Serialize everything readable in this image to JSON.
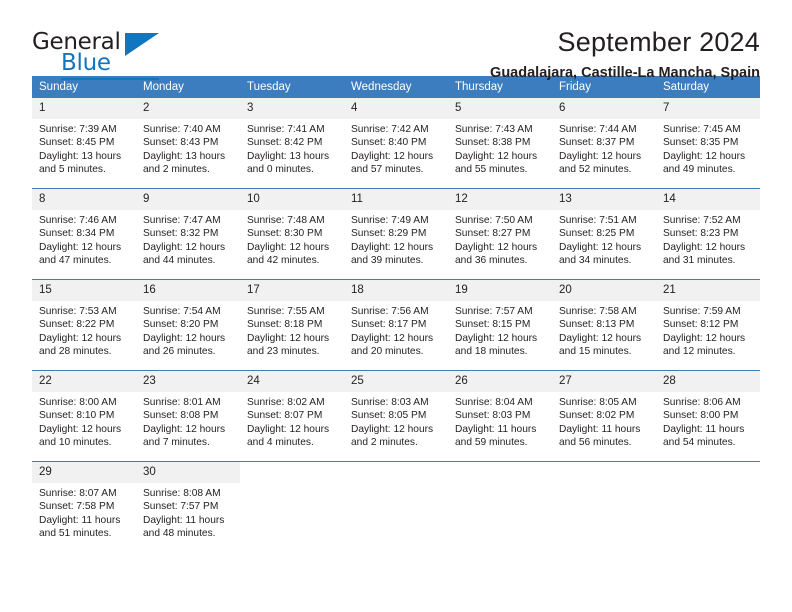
{
  "brand": {
    "name_top": "General",
    "name_bottom": "Blue",
    "accent_color": "#1175c0"
  },
  "header": {
    "title": "September 2024",
    "subtitle": "Guadalajara, Castille-La Mancha, Spain"
  },
  "theme": {
    "header_row_bg": "#3b7dbf",
    "daynum_bg": "#f1f1f1",
    "text_color": "#231f20",
    "grid_line": "#3b7dbf"
  },
  "weekday_headers": [
    "Sunday",
    "Monday",
    "Tuesday",
    "Wednesday",
    "Thursday",
    "Friday",
    "Saturday"
  ],
  "labels": {
    "sunrise_prefix": "Sunrise:",
    "sunset_prefix": "Sunset:",
    "daylight_prefix": "Daylight:"
  },
  "weeks": [
    [
      {
        "day": "1",
        "sunrise": "Sunrise: 7:39 AM",
        "sunset": "Sunset: 8:45 PM",
        "daylight_1": "Daylight: 13 hours",
        "daylight_2": "and 5 minutes."
      },
      {
        "day": "2",
        "sunrise": "Sunrise: 7:40 AM",
        "sunset": "Sunset: 8:43 PM",
        "daylight_1": "Daylight: 13 hours",
        "daylight_2": "and 2 minutes."
      },
      {
        "day": "3",
        "sunrise": "Sunrise: 7:41 AM",
        "sunset": "Sunset: 8:42 PM",
        "daylight_1": "Daylight: 13 hours",
        "daylight_2": "and 0 minutes."
      },
      {
        "day": "4",
        "sunrise": "Sunrise: 7:42 AM",
        "sunset": "Sunset: 8:40 PM",
        "daylight_1": "Daylight: 12 hours",
        "daylight_2": "and 57 minutes."
      },
      {
        "day": "5",
        "sunrise": "Sunrise: 7:43 AM",
        "sunset": "Sunset: 8:38 PM",
        "daylight_1": "Daylight: 12 hours",
        "daylight_2": "and 55 minutes."
      },
      {
        "day": "6",
        "sunrise": "Sunrise: 7:44 AM",
        "sunset": "Sunset: 8:37 PM",
        "daylight_1": "Daylight: 12 hours",
        "daylight_2": "and 52 minutes."
      },
      {
        "day": "7",
        "sunrise": "Sunrise: 7:45 AM",
        "sunset": "Sunset: 8:35 PM",
        "daylight_1": "Daylight: 12 hours",
        "daylight_2": "and 49 minutes."
      }
    ],
    [
      {
        "day": "8",
        "sunrise": "Sunrise: 7:46 AM",
        "sunset": "Sunset: 8:34 PM",
        "daylight_1": "Daylight: 12 hours",
        "daylight_2": "and 47 minutes."
      },
      {
        "day": "9",
        "sunrise": "Sunrise: 7:47 AM",
        "sunset": "Sunset: 8:32 PM",
        "daylight_1": "Daylight: 12 hours",
        "daylight_2": "and 44 minutes."
      },
      {
        "day": "10",
        "sunrise": "Sunrise: 7:48 AM",
        "sunset": "Sunset: 8:30 PM",
        "daylight_1": "Daylight: 12 hours",
        "daylight_2": "and 42 minutes."
      },
      {
        "day": "11",
        "sunrise": "Sunrise: 7:49 AM",
        "sunset": "Sunset: 8:29 PM",
        "daylight_1": "Daylight: 12 hours",
        "daylight_2": "and 39 minutes."
      },
      {
        "day": "12",
        "sunrise": "Sunrise: 7:50 AM",
        "sunset": "Sunset: 8:27 PM",
        "daylight_1": "Daylight: 12 hours",
        "daylight_2": "and 36 minutes."
      },
      {
        "day": "13",
        "sunrise": "Sunrise: 7:51 AM",
        "sunset": "Sunset: 8:25 PM",
        "daylight_1": "Daylight: 12 hours",
        "daylight_2": "and 34 minutes."
      },
      {
        "day": "14",
        "sunrise": "Sunrise: 7:52 AM",
        "sunset": "Sunset: 8:23 PM",
        "daylight_1": "Daylight: 12 hours",
        "daylight_2": "and 31 minutes."
      }
    ],
    [
      {
        "day": "15",
        "sunrise": "Sunrise: 7:53 AM",
        "sunset": "Sunset: 8:22 PM",
        "daylight_1": "Daylight: 12 hours",
        "daylight_2": "and 28 minutes."
      },
      {
        "day": "16",
        "sunrise": "Sunrise: 7:54 AM",
        "sunset": "Sunset: 8:20 PM",
        "daylight_1": "Daylight: 12 hours",
        "daylight_2": "and 26 minutes."
      },
      {
        "day": "17",
        "sunrise": "Sunrise: 7:55 AM",
        "sunset": "Sunset: 8:18 PM",
        "daylight_1": "Daylight: 12 hours",
        "daylight_2": "and 23 minutes."
      },
      {
        "day": "18",
        "sunrise": "Sunrise: 7:56 AM",
        "sunset": "Sunset: 8:17 PM",
        "daylight_1": "Daylight: 12 hours",
        "daylight_2": "and 20 minutes."
      },
      {
        "day": "19",
        "sunrise": "Sunrise: 7:57 AM",
        "sunset": "Sunset: 8:15 PM",
        "daylight_1": "Daylight: 12 hours",
        "daylight_2": "and 18 minutes."
      },
      {
        "day": "20",
        "sunrise": "Sunrise: 7:58 AM",
        "sunset": "Sunset: 8:13 PM",
        "daylight_1": "Daylight: 12 hours",
        "daylight_2": "and 15 minutes."
      },
      {
        "day": "21",
        "sunrise": "Sunrise: 7:59 AM",
        "sunset": "Sunset: 8:12 PM",
        "daylight_1": "Daylight: 12 hours",
        "daylight_2": "and 12 minutes."
      }
    ],
    [
      {
        "day": "22",
        "sunrise": "Sunrise: 8:00 AM",
        "sunset": "Sunset: 8:10 PM",
        "daylight_1": "Daylight: 12 hours",
        "daylight_2": "and 10 minutes."
      },
      {
        "day": "23",
        "sunrise": "Sunrise: 8:01 AM",
        "sunset": "Sunset: 8:08 PM",
        "daylight_1": "Daylight: 12 hours",
        "daylight_2": "and 7 minutes."
      },
      {
        "day": "24",
        "sunrise": "Sunrise: 8:02 AM",
        "sunset": "Sunset: 8:07 PM",
        "daylight_1": "Daylight: 12 hours",
        "daylight_2": "and 4 minutes."
      },
      {
        "day": "25",
        "sunrise": "Sunrise: 8:03 AM",
        "sunset": "Sunset: 8:05 PM",
        "daylight_1": "Daylight: 12 hours",
        "daylight_2": "and 2 minutes."
      },
      {
        "day": "26",
        "sunrise": "Sunrise: 8:04 AM",
        "sunset": "Sunset: 8:03 PM",
        "daylight_1": "Daylight: 11 hours",
        "daylight_2": "and 59 minutes."
      },
      {
        "day": "27",
        "sunrise": "Sunrise: 8:05 AM",
        "sunset": "Sunset: 8:02 PM",
        "daylight_1": "Daylight: 11 hours",
        "daylight_2": "and 56 minutes."
      },
      {
        "day": "28",
        "sunrise": "Sunrise: 8:06 AM",
        "sunset": "Sunset: 8:00 PM",
        "daylight_1": "Daylight: 11 hours",
        "daylight_2": "and 54 minutes."
      }
    ],
    [
      {
        "day": "29",
        "sunrise": "Sunrise: 8:07 AM",
        "sunset": "Sunset: 7:58 PM",
        "daylight_1": "Daylight: 11 hours",
        "daylight_2": "and 51 minutes."
      },
      {
        "day": "30",
        "sunrise": "Sunrise: 8:08 AM",
        "sunset": "Sunset: 7:57 PM",
        "daylight_1": "Daylight: 11 hours",
        "daylight_2": "and 48 minutes."
      },
      {
        "day": "",
        "sunrise": "",
        "sunset": "",
        "daylight_1": "",
        "daylight_2": ""
      },
      {
        "day": "",
        "sunrise": "",
        "sunset": "",
        "daylight_1": "",
        "daylight_2": ""
      },
      {
        "day": "",
        "sunrise": "",
        "sunset": "",
        "daylight_1": "",
        "daylight_2": ""
      },
      {
        "day": "",
        "sunrise": "",
        "sunset": "",
        "daylight_1": "",
        "daylight_2": ""
      },
      {
        "day": "",
        "sunrise": "",
        "sunset": "",
        "daylight_1": "",
        "daylight_2": ""
      }
    ]
  ]
}
